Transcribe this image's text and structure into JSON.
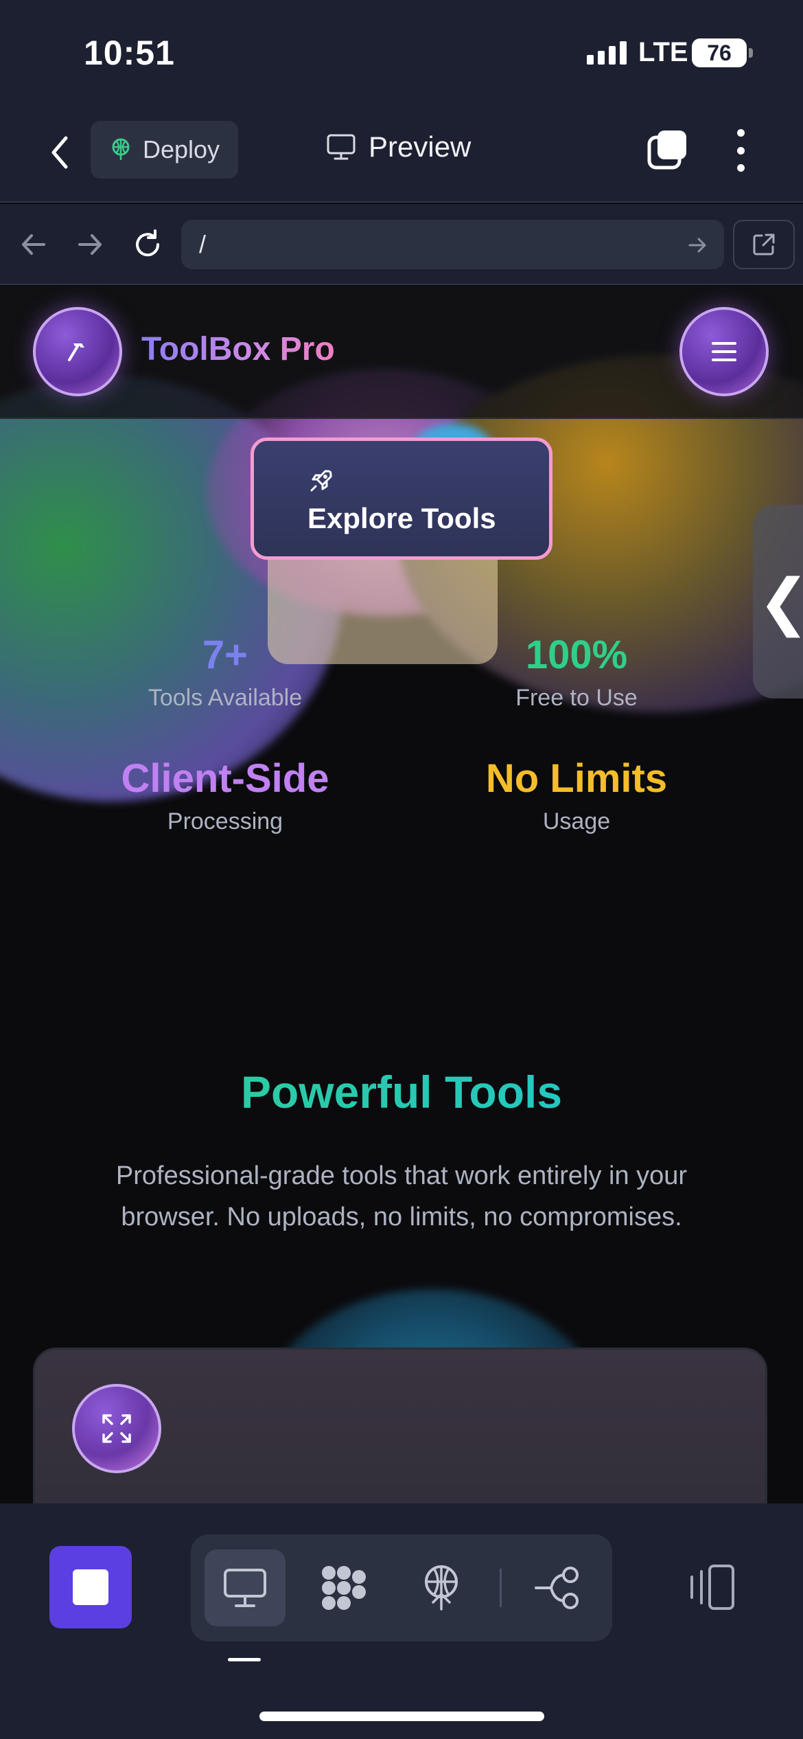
{
  "status_bar": {
    "time": "10:51",
    "network": "LTE",
    "battery": "76"
  },
  "toolbar": {
    "deploy_label": "Deploy",
    "title": "Preview"
  },
  "url_bar": {
    "url": "/"
  },
  "site": {
    "brand": "ToolBox Pro",
    "explore_label": "Explore Tools",
    "stats": [
      {
        "value": "7+",
        "label": "Tools Available",
        "color": "#7b82ef"
      },
      {
        "value": "100%",
        "label": "Free to Use",
        "color": "#2fcf8a"
      },
      {
        "value": "Client-Side",
        "label": "Processing",
        "color": "#c081f2"
      },
      {
        "value": "No Limits",
        "label": "Usage",
        "color": "#f4bd29"
      }
    ],
    "section_title": "Powerful Tools",
    "section_desc": "Professional-grade tools that work entirely in your browser. No uploads, no limits, no compromises.",
    "side_tab_glyph": "❮"
  },
  "colors": {
    "accent": "#5b3fe0",
    "chrome": "#1c2030",
    "field": "#2c3142"
  }
}
